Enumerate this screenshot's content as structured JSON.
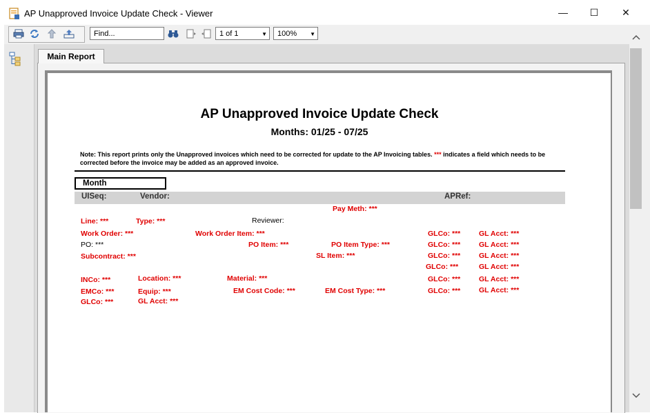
{
  "window": {
    "title": "AP Unapproved Invoice Update Check - Viewer",
    "minimize": "—",
    "maximize": "☐",
    "close": "✕"
  },
  "toolbar": {
    "find_placeholder": "Find...",
    "page_value": "1 of 1",
    "zoom_value": "100%"
  },
  "tabs": {
    "main_report": "Main Report"
  },
  "scrollbar": {
    "up": "⌃",
    "down": "⌄"
  },
  "report": {
    "title": "AP Unapproved Invoice Update Check",
    "subtitle": "Months: 01/25 - 07/25",
    "note_prefix": "Note:  This report prints only the Unapproved invoices which need to be corrected for update to the AP Invoicing tables.  ",
    "note_marker": "***",
    "note_suffix": " indicates a field which needs to be corrected before the invoice may be added as an approved invoice.",
    "month_label": "Month",
    "header_band": {
      "uiseq": "UISeq:",
      "vendor": "Vendor:",
      "apref": "APRef:"
    },
    "fields": {
      "pay_meth": "Pay Meth:  ***",
      "line": "Line:  ***",
      "type": "Type:  ***",
      "reviewer": "Reviewer:",
      "work_order": "Work Order:  ***",
      "work_order_item": "Work Order Item:  ***",
      "glco_1": "GLCo:  ***",
      "glacct_1": "GL Acct:  ***",
      "po": "PO:  ***",
      "po_item": "PO Item:  ***",
      "po_item_type": "PO Item Type:  ***",
      "glco_2": "GLCo:  ***",
      "glacct_2": "GL Acct:  ***",
      "subcontract": "Subcontract:  ***",
      "sl_item": "SL Item:  ***",
      "glco_3": "GLCo:  ***",
      "glacct_3": "GL Acct:  ***",
      "glco_4": "GLCo:  ***",
      "glacct_4": "GL Acct:  ***",
      "inco": "INCo:  ***",
      "location": "Location:  ***",
      "material": "Material:  ***",
      "glco_5": "GLCo:  ***",
      "glacct_5": "GL Acct:  ***",
      "emco": "EMCo:  ***",
      "equip": "Equip:  ***",
      "em_cost_code": "EM Cost Code:  ***",
      "em_cost_type": "EM Cost Type:  ***",
      "glco_6": "GLCo:  ***",
      "glacct_6": "GL Acct:  ***",
      "glco_7": "GLCo:  ***",
      "glacct_7": "GL Acct:  ***"
    }
  },
  "colors": {
    "error_red": "#e00000",
    "band_gray": "#d3d3d3"
  }
}
